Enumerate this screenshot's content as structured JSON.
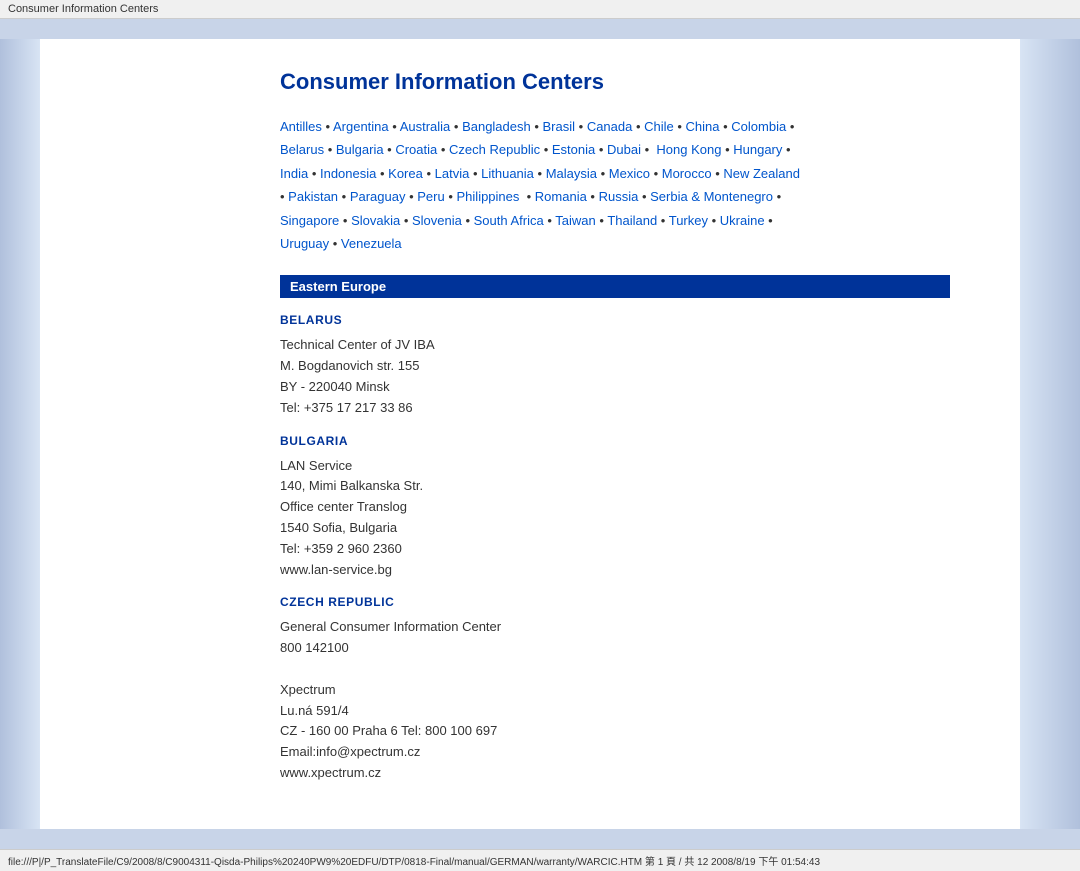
{
  "titlebar": {
    "text": "Consumer Information Centers"
  },
  "page": {
    "title": "Consumer Information Centers"
  },
  "links": {
    "items": [
      "Antilles",
      "Argentina",
      "Australia",
      "Bangladesh",
      "Brasil",
      "Canada",
      "Chile",
      "China",
      "Colombia",
      "Belarus",
      "Bulgaria",
      "Croatia",
      "Czech Republic",
      "Estonia",
      "Dubai",
      "Hong Kong",
      "Hungary",
      "India",
      "Indonesia",
      "Korea",
      "Latvia",
      "Lithuania",
      "Malaysia",
      "Mexico",
      "Morocco",
      "New Zealand",
      "Pakistan",
      "Paraguay",
      "Peru",
      "Philippines",
      "Romania",
      "Russia",
      "Serbia & Montenegro",
      "Singapore",
      "Slovakia",
      "Slovenia",
      "South Africa",
      "Taiwan",
      "Thailand",
      "Turkey",
      "Ukraine",
      "Uruguay",
      "Venezuela"
    ]
  },
  "section": {
    "header": "Eastern Europe"
  },
  "countries": [
    {
      "name": "BELARUS",
      "lines": [
        "Technical Center of JV IBA",
        "M. Bogdanovich str. 155",
        "BY - 220040 Minsk",
        "Tel: +375 17 217 33 86"
      ]
    },
    {
      "name": "BULGARIA",
      "lines": [
        "LAN Service",
        "140, Mimi Balkanska Str.",
        "Office center Translog",
        "1540 Sofia, Bulgaria",
        "Tel: +359 2 960 2360",
        "www.lan-service.bg"
      ]
    },
    {
      "name": "CZECH REPUBLIC",
      "lines": [
        "General Consumer Information Center",
        "800 142100",
        "",
        "Xpectrum",
        "Lu.ná 591/4",
        "CZ - 160 00 Praha 6 Tel: 800 100 697",
        "Email:info@xpectrum.cz",
        "www.xpectrum.cz"
      ]
    }
  ],
  "statusbar": {
    "text": "file:///P|/P_TranslateFile/C9/2008/8/C9004311-Qisda-Philips%20240PW9%20EDFU/DTP/0818-Final/manual/GERMAN/warranty/WARCIC.HTM 第 1 頁 / 共 12 2008/8/19 下午 01:54:43"
  }
}
